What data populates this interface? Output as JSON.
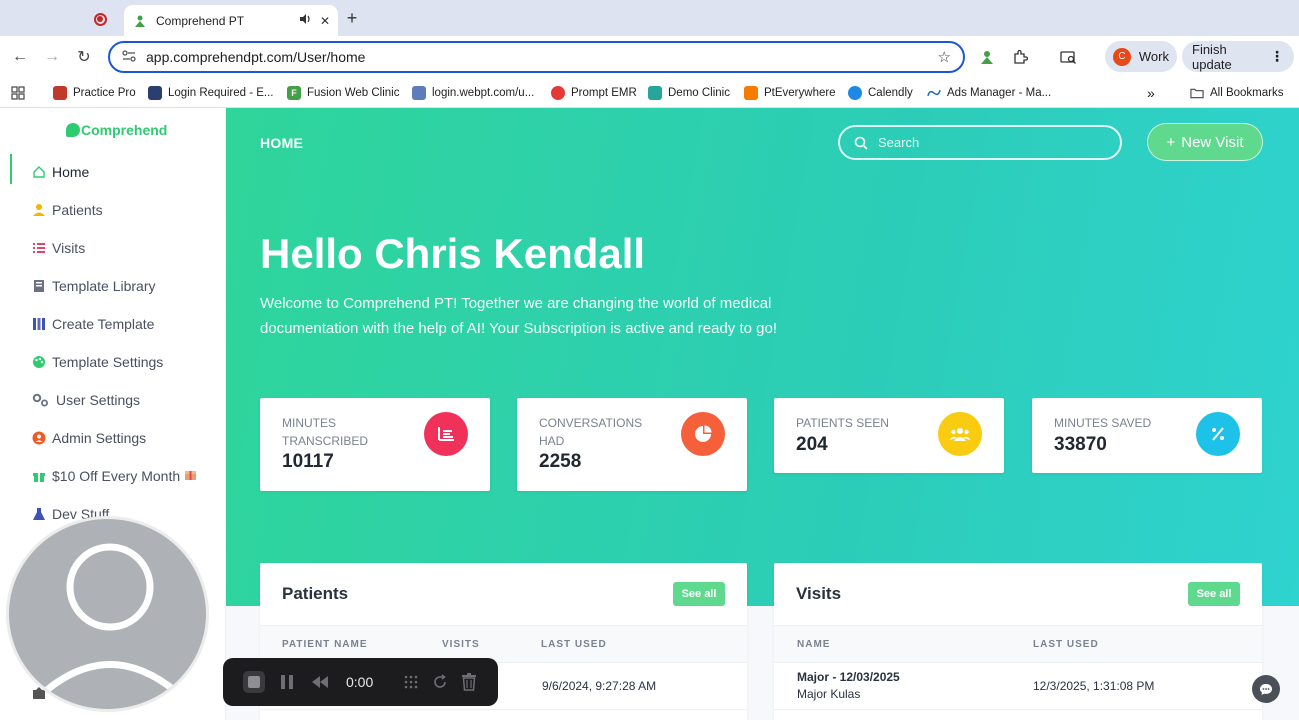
{
  "browser": {
    "active_tab_title": "Comprehend PT",
    "url": "app.comprehendpt.com/User/home",
    "profile_initial": "C",
    "profile_name": "Work",
    "update_label": "Finish update",
    "bookmarks": [
      {
        "label": "Practice Pro",
        "icon": "practice-pro-icon",
        "color": "#c0392b"
      },
      {
        "label": "Login Required - E...",
        "icon": "login-required-icon",
        "color": "#2c3e70"
      },
      {
        "label": "Fusion Web Clinic",
        "icon": "fusion-icon",
        "color": "#43a047"
      },
      {
        "label": "login.webpt.com/u...",
        "icon": "webpt-icon",
        "color": "#5c7cba"
      },
      {
        "label": "Prompt EMR",
        "icon": "prompt-emr-icon",
        "color": "#e53935"
      },
      {
        "label": "Demo Clinic",
        "icon": "demo-clinic-icon",
        "color": "#26a69a"
      },
      {
        "label": "PtEverywhere",
        "icon": "pteverywhere-icon",
        "color": "#f57c00"
      },
      {
        "label": "Calendly",
        "icon": "calendly-icon",
        "color": "#1e88e5"
      },
      {
        "label": "Ads Manager - Ma...",
        "icon": "meta-icon",
        "color": "#1565c0"
      }
    ],
    "all_bookmarks_label": "All Bookmarks"
  },
  "sidebar": {
    "brand": "Comprehend",
    "items": [
      {
        "label": "Home",
        "icon": "home-icon"
      },
      {
        "label": "Patients",
        "icon": "person-icon"
      },
      {
        "label": "Visits",
        "icon": "list-icon"
      },
      {
        "label": "Template Library",
        "icon": "book-icon"
      },
      {
        "label": "Create Template",
        "icon": "template-icon"
      },
      {
        "label": "Template Settings",
        "icon": "palette-icon"
      },
      {
        "label": "User Settings",
        "icon": "gears-icon"
      },
      {
        "label": "Admin Settings",
        "icon": "admin-icon"
      },
      {
        "label": "$10 Off Every Month",
        "icon": "gift-icon"
      },
      {
        "label": "Dev Stuff",
        "icon": "flask-icon"
      }
    ]
  },
  "header": {
    "title": "HOME",
    "search_placeholder": "Search",
    "new_visit_label": "New Visit"
  },
  "hero": {
    "greeting": "Hello Chris Kendall",
    "welcome_line1": "Welcome to Comprehend PT! Together we are changing the world of medical",
    "welcome_line2": "documentation with the help of AI! Your Subscription is active and ready to go!"
  },
  "stats": [
    {
      "label": "Minutes Transcribed",
      "value": "10117",
      "icon": "bar-chart-icon",
      "color": "#f0325b"
    },
    {
      "label": "Conversations Had",
      "value": "2258",
      "icon": "pie-chart-icon",
      "color": "#f5603a"
    },
    {
      "label": "Patients Seen",
      "value": "204",
      "icon": "users-icon",
      "color": "#f9cc12"
    },
    {
      "label": "Minutes Saved",
      "value": "33870",
      "icon": "percent-icon",
      "color": "#1ec2e8"
    }
  ],
  "patients_card": {
    "title": "Patients",
    "see_all": "See all",
    "columns": [
      "PATIENT NAME",
      "VISITS",
      "LAST USED"
    ],
    "rows": [
      {
        "name": "",
        "visits": "",
        "last_used": "9/6/2024, 9:27:28 AM"
      }
    ]
  },
  "visits_card": {
    "title": "Visits",
    "see_all": "See all",
    "columns": [
      "NAME",
      "LAST USED"
    ],
    "rows": [
      {
        "name": "Major - 12/03/2025",
        "sub": "Major Kulas",
        "last_used": "12/3/2025, 1:31:08 PM"
      }
    ]
  },
  "recorder": {
    "time": "0:00"
  },
  "colors": {
    "accent": "#2ecc71",
    "hero_start": "#2fd59a",
    "hero_end": "#2fd3cf",
    "button_green": "#5fd98d"
  }
}
